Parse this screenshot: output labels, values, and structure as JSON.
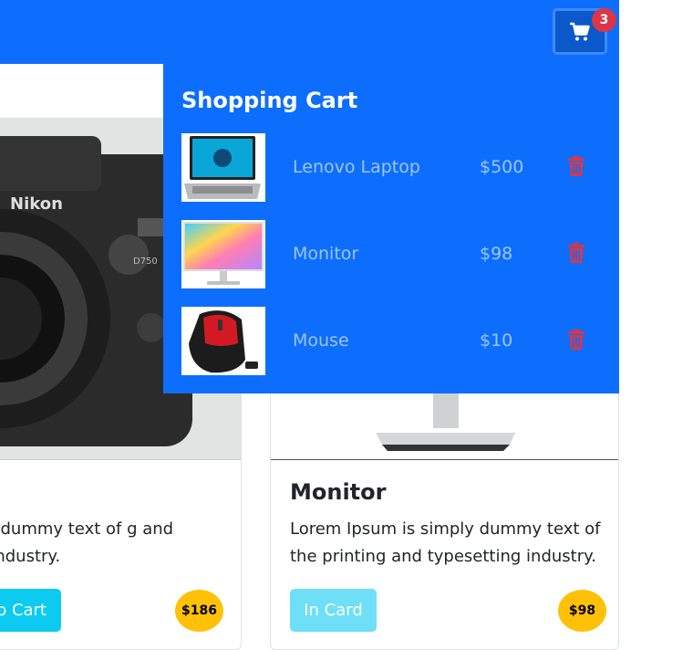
{
  "navbar": {
    "cart_count": "3",
    "cart_icon": "cart-icon"
  },
  "cart": {
    "title": "Shopping Cart",
    "items": [
      {
        "name": "Lenovo Laptop",
        "price": "$500",
        "thumb": "laptop-image",
        "remove_icon": "trash-icon"
      },
      {
        "name": "Monitor",
        "price": "$98",
        "thumb": "monitor-image",
        "remove_icon": "trash-icon"
      },
      {
        "name": "Mouse",
        "price": "$10",
        "thumb": "mouse-image",
        "remove_icon": "trash-icon"
      }
    ]
  },
  "products": [
    {
      "image": "camera-image",
      "text": "um is simply dummy text of g and typesetting industry.",
      "button": "o Cart",
      "price": "$186"
    },
    {
      "image": "monitor-image",
      "title": "Monitor",
      "text": "Lorem Ipsum is simply dummy text of the printing and typesetting industry.",
      "button": "In Card",
      "price": "$98"
    }
  ],
  "colors": {
    "primary": "#0d6efd",
    "badge": "#dc3545",
    "price_badge": "#ffc107",
    "info_button": "#0dcaf0",
    "trash": "#dc3545",
    "cart_text": "#9ec5fe"
  }
}
